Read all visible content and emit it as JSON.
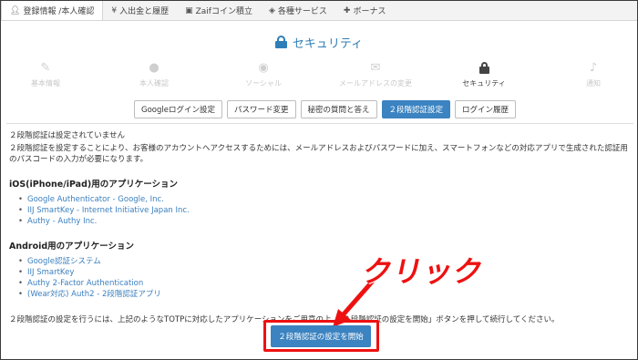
{
  "topnav": {
    "tabs": [
      {
        "icon": "user-icon",
        "label": "登録情報 /本人確認",
        "active": true
      },
      {
        "icon": "yen-icon",
        "label": "入出金と履歴",
        "active": false
      },
      {
        "icon": "wallet-icon",
        "label": "Zaifコイン積立",
        "active": false
      },
      {
        "icon": "tag-icon",
        "label": "各種サービス",
        "active": false
      },
      {
        "icon": "gift-icon",
        "label": "ボーナス",
        "active": false
      }
    ]
  },
  "header": {
    "title": "セキュリティ"
  },
  "steps": [
    {
      "icon": "pencil-icon",
      "label": "基本情報",
      "active": false
    },
    {
      "icon": "person-icon",
      "label": "本人確認",
      "active": false
    },
    {
      "icon": "globe-icon",
      "label": "ソーシャル",
      "active": false
    },
    {
      "icon": "envelope-icon",
      "label": "メールアドレスの変更",
      "active": false
    },
    {
      "icon": "lock-icon",
      "label": "セキュリティ",
      "active": true
    },
    {
      "icon": "bell-icon",
      "label": "通知",
      "active": false
    }
  ],
  "subtabs": [
    {
      "label": "Googleログイン設定",
      "active": false
    },
    {
      "label": "パスワード変更",
      "active": false
    },
    {
      "label": "秘密の質問と答え",
      "active": false
    },
    {
      "label": "２段階認証設定",
      "active": true
    },
    {
      "label": "ログイン履歴",
      "active": false
    }
  ],
  "content": {
    "status": "２段階認証は設定されていません",
    "description": "２段階認証を設定することにより、お客様のアカウントへアクセスするためには、メールアドレスおよびパスワードに加え、スマートフォンなどの対応アプリで生成された認証用のパスコードの入力が必要になります。",
    "ios_heading": "iOS(iPhone/iPad)用のアプリケーション",
    "ios_apps": [
      "Google Authenticator - Google, Inc.",
      "IIJ SmartKey - Internet Initiative Japan Inc.",
      "Authy - Authy Inc."
    ],
    "android_heading": "Android用のアプリケーション",
    "android_apps": [
      "Google認証システム",
      "IIJ SmartKey",
      "Authy 2-Factor Authentication",
      "(Wear対応) Auth2 - 2段階認証アプリ"
    ],
    "instruction": "２段階認証の設定を行うには、上記のようなTOTPに対応したアプリケーションをご用意の上、「２段階認証の設定を開始」ボタンを押して続行してください。"
  },
  "start_button": {
    "label": "２段階認証の設定を開始"
  },
  "annotation": {
    "label": "クリック",
    "color": "#ee1111"
  },
  "colors": {
    "accent": "#3b83c1",
    "title": "#2e7fb8",
    "link": "#3a7fbf"
  }
}
